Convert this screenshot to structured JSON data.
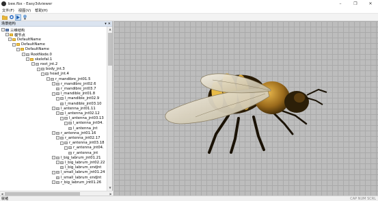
{
  "window": {
    "title": "bee.fbx - Easy3dviewer",
    "minimize_icon": "minimize-icon",
    "restore_icon": "restore-icon",
    "close_icon": "close-icon"
  },
  "menu": {
    "items": [
      "文件(F)",
      "视图(V)",
      "帮助(H)"
    ]
  },
  "toolbar": {
    "buttons": [
      "open-icon",
      "view-icon",
      "play-icon",
      "light-icon"
    ]
  },
  "scene_panel": {
    "title": "场景结构",
    "pin": "▾",
    "pin_icon": "pin-icon",
    "close": "✕",
    "close_icon": "close-icon",
    "tree": [
      {
        "label": "三维结构",
        "icon": "root",
        "exp": "-"
      },
      {
        "label": "模节点",
        "icon": "folder",
        "exp": "-"
      },
      {
        "label": "DefaultName",
        "icon": "folder",
        "exp": "-"
      },
      {
        "label": "DefaultName",
        "icon": "folder",
        "exp": "-"
      },
      {
        "label": "DefaultName",
        "icon": "folder",
        "exp": "-"
      },
      {
        "label": "RootNode.0",
        "icon": "node",
        "exp": "-"
      },
      {
        "label": "skelefal.1",
        "icon": "folder",
        "exp": "-"
      },
      {
        "label": "root_jnt.2",
        "icon": "node",
        "exp": "-"
      },
      {
        "label": "body_jnt.3",
        "icon": "node",
        "exp": "-"
      },
      {
        "label": "head_jnt.4",
        "icon": "node",
        "exp": "-"
      },
      {
        "label": "r_mandibre_jnt01.5",
        "icon": "node",
        "exp": "-"
      },
      {
        "label": "r_mandibre_jnt02.6",
        "icon": "node",
        "exp": "-"
      },
      {
        "label": "r_mandibre_jnt03.7",
        "icon": "node",
        "exp": ""
      },
      {
        "label": "l_mandible_jnt01.8",
        "icon": "node",
        "exp": "-"
      },
      {
        "label": "l_mandible_jnt02.9",
        "icon": "node",
        "exp": "-"
      },
      {
        "label": "l_mandible_jnt03.10",
        "icon": "node",
        "exp": ""
      },
      {
        "label": "l_antenna_jnt01.11",
        "icon": "node",
        "exp": "-"
      },
      {
        "label": "l_antenna_jnt02.12",
        "icon": "node",
        "exp": "-"
      },
      {
        "label": "l_antenna_jnt03.13",
        "icon": "node",
        "exp": "-"
      },
      {
        "label": "l_antenna_jnt04.",
        "icon": "node",
        "exp": "-"
      },
      {
        "label": "l_antenna_jnt",
        "icon": "node",
        "exp": ""
      },
      {
        "label": "r_antenna_jnt01.16",
        "icon": "node",
        "exp": "-"
      },
      {
        "label": "r_antenna_jnt02.17",
        "icon": "node",
        "exp": "-"
      },
      {
        "label": "r_antenna_jnt03.18",
        "icon": "node",
        "exp": "-"
      },
      {
        "label": "r_antenna_jnt04.",
        "icon": "node",
        "exp": "-"
      },
      {
        "label": "r_antenna_jnt",
        "icon": "node",
        "exp": ""
      },
      {
        "label": "l_big_labrum_jnt01.21",
        "icon": "node",
        "exp": "-"
      },
      {
        "label": "l_big_labrum_jnt02.22",
        "icon": "node",
        "exp": "-"
      },
      {
        "label": "l_big_labrum_endJnt",
        "icon": "node",
        "exp": ""
      },
      {
        "label": "l_small_labrum_jnt01.24",
        "icon": "node",
        "exp": "-"
      },
      {
        "label": "l_small_labrum_endJnt",
        "icon": "node",
        "exp": ""
      },
      {
        "label": "r_big_labrum_jnt01.26",
        "icon": "node",
        "exp": "-"
      }
    ]
  },
  "status": {
    "left": "就绪",
    "right": "CAP NUM SCRL"
  }
}
